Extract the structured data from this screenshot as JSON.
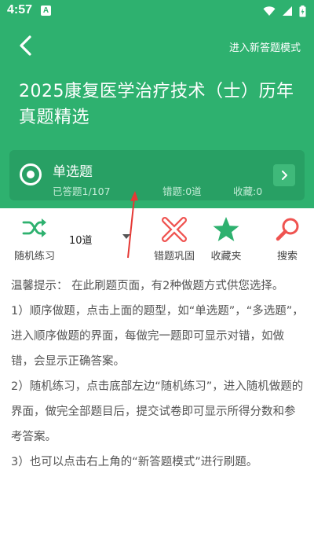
{
  "status_bar": {
    "time": "4:57",
    "notification_badge": "A"
  },
  "header": {
    "back_label": "back",
    "new_mode_label": "进入新答题模式",
    "title": "2025康复医学治疗技术（士）历年真题精选"
  },
  "question_type": {
    "name": "单选题",
    "answered": "已答题1/107",
    "wrong": "错题:0道",
    "favorites": "收藏:0"
  },
  "toolbar": {
    "random_label": "随机练习",
    "count_value": "10道",
    "wrong_label": "错题巩固",
    "fav_label": "收藏夹",
    "search_label": "搜索"
  },
  "tips": {
    "line1": "温馨提示： 在此刷题页面，有2种做题方式供您选择。",
    "line2": "1）顺序做题，点击上面的题型，如“单选题”，“多选题”，进入顺序做题的界面，每做完一题即可显示对错，如做错，会显示正确答案。",
    "line3": "2）随机练习，点击底部左边“随机练习”，进入随机做题的界面，做完全部题目后，提交试卷即可显示所得分数和参考答案。",
    "line4": "3）也可以点击右上角的“新答题模式”进行刷题。"
  },
  "colors": {
    "header_green": "#2eb16f",
    "card_green": "#28a064",
    "wrong_red": "#ef5350",
    "star_green": "#2eb16f",
    "search_red": "#ef5350",
    "random_green": "#2eb16f"
  },
  "icons": [
    "back-arrow-icon",
    "radio-icon",
    "chevron-right-icon",
    "shuffle-icon",
    "cross-icon",
    "star-icon",
    "search-icon"
  ]
}
